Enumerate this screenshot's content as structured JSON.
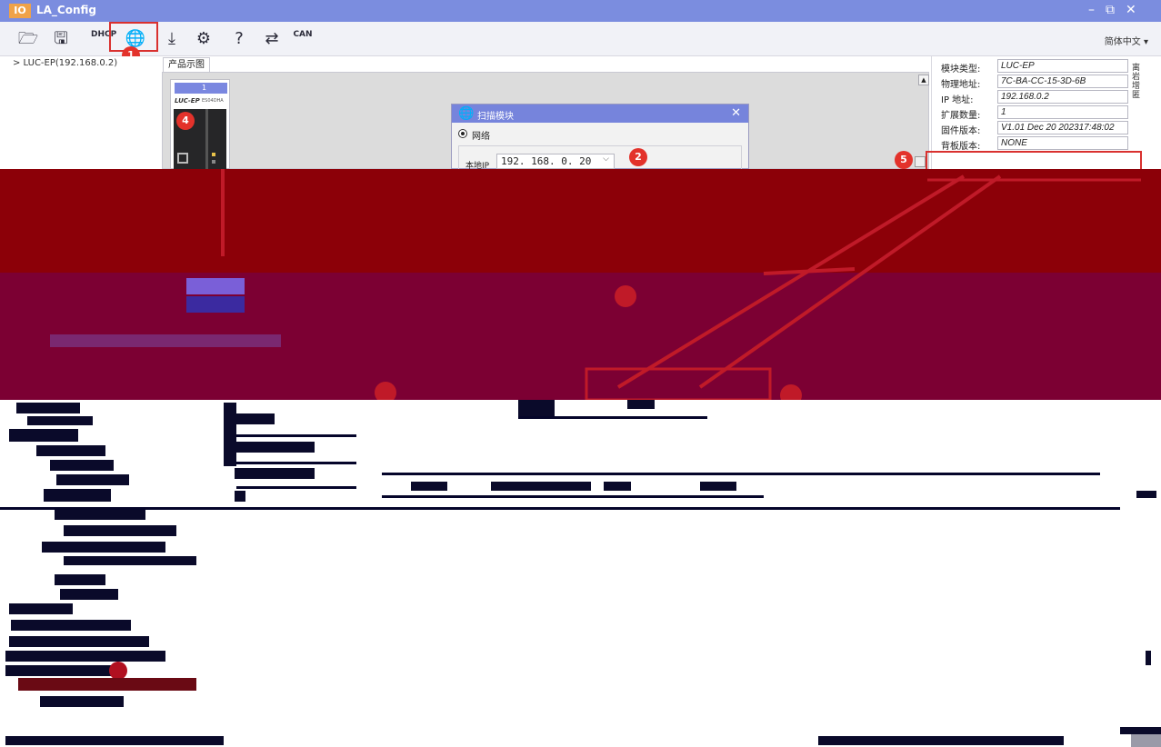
{
  "window": {
    "app_badge": "IO",
    "title": "LA_Config",
    "controls": {
      "minimize": "–",
      "restore": "⧉",
      "close": "✕"
    }
  },
  "toolbar": {
    "tools": [
      {
        "name": "open-icon",
        "glyph": "🗁"
      },
      {
        "name": "save-icon",
        "glyph": "🖫"
      },
      {
        "name": "dhcp-icon",
        "glyph": "DHCP"
      },
      {
        "name": "scan-network-icon",
        "glyph": "🌐"
      },
      {
        "name": "download-icon",
        "glyph": "⤓"
      },
      {
        "name": "settings-icon",
        "glyph": "⚙"
      },
      {
        "name": "help-icon",
        "glyph": "?"
      },
      {
        "name": "compare-icon",
        "glyph": "⇄"
      },
      {
        "name": "can-icon",
        "glyph": "CAN"
      }
    ],
    "language": "简体中文 ▾"
  },
  "tree": {
    "items": [
      {
        "label": "> LUC-EP(192.168.0.2)"
      }
    ]
  },
  "canvas": {
    "tab_label": "产品示图",
    "device": {
      "slot": "1",
      "name": "LUC-EP",
      "sub": "ES04DHA"
    }
  },
  "scan_dialog": {
    "title": "扫描模块",
    "radio_network": "网络",
    "local_ip_label": "本地IP",
    "local_ip_value": "192. 168. 0. 20"
  },
  "properties": {
    "rows": [
      {
        "label": "模块类型:",
        "value": "LUC-EP"
      },
      {
        "label": "物理地址:",
        "value": "7C-BA-CC-15-3D-6B"
      },
      {
        "label": " IP 地址:",
        "value": "192.168.0.2"
      },
      {
        "label": "扩展数量:",
        "value": "1"
      },
      {
        "label": "固件版本:",
        "value": "V1.01 Dec 20 202317:48:02"
      },
      {
        "label": "背板版本:",
        "value": "NONE"
      }
    ],
    "side_text": "离 岩 增 匿"
  },
  "annotations": {
    "badges": [
      "1",
      "2",
      "4",
      "5"
    ],
    "accent_color": "#e3322b",
    "title_bar_color": "#7b8ddf"
  }
}
